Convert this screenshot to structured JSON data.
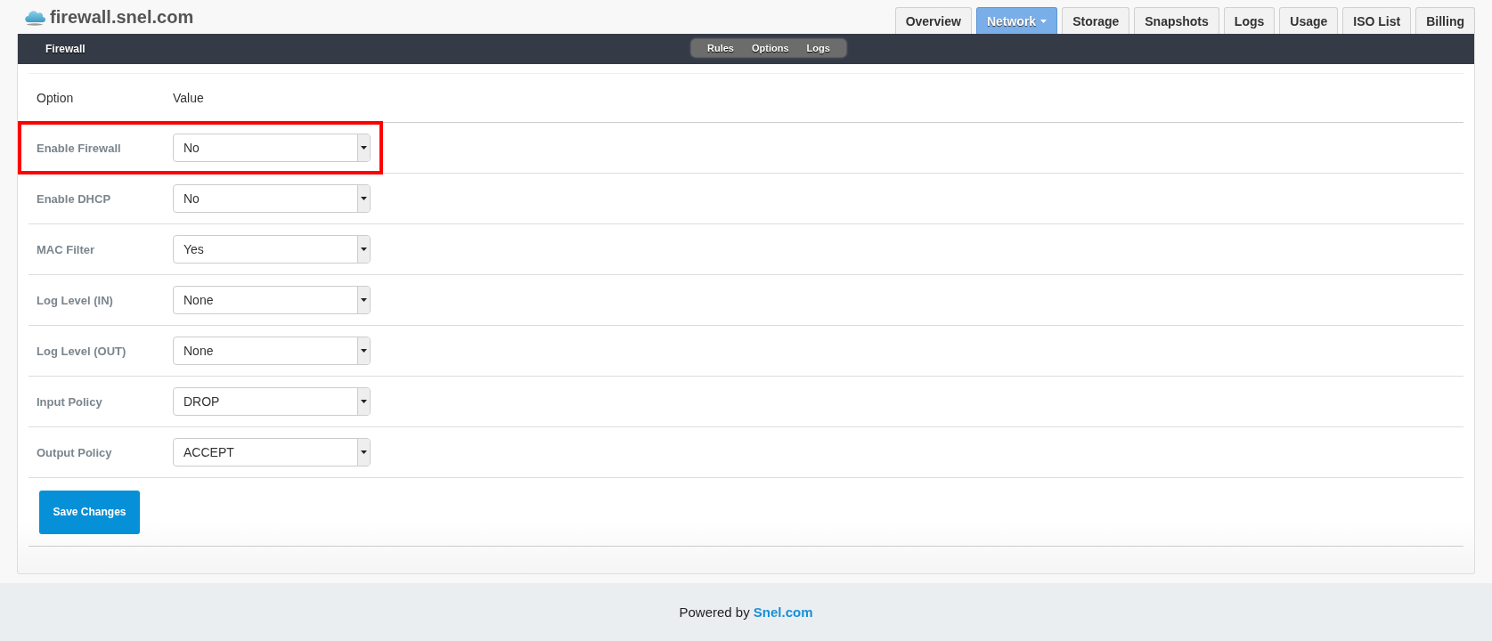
{
  "site": {
    "title": "firewall.snel.com"
  },
  "tabs": [
    {
      "label": "Overview",
      "selected": false,
      "dropdown": false
    },
    {
      "label": "Network",
      "selected": true,
      "dropdown": true
    },
    {
      "label": "Storage",
      "selected": false,
      "dropdown": false
    },
    {
      "label": "Snapshots",
      "selected": false,
      "dropdown": false
    },
    {
      "label": "Logs",
      "selected": false,
      "dropdown": false
    },
    {
      "label": "Usage",
      "selected": false,
      "dropdown": false
    },
    {
      "label": "ISO List",
      "selected": false,
      "dropdown": false
    },
    {
      "label": "Billing",
      "selected": false,
      "dropdown": false
    }
  ],
  "section": {
    "title": "Firewall",
    "subtabs": [
      {
        "label": "Rules"
      },
      {
        "label": "Options"
      },
      {
        "label": "Logs"
      }
    ]
  },
  "table": {
    "columns": [
      "Option",
      "Value"
    ],
    "rows": [
      {
        "option": "Enable Firewall",
        "value": "No",
        "highlighted": true
      },
      {
        "option": "Enable DHCP",
        "value": "No",
        "highlighted": false
      },
      {
        "option": "MAC Filter",
        "value": "Yes",
        "highlighted": false
      },
      {
        "option": "Log Level (IN)",
        "value": "None",
        "highlighted": false
      },
      {
        "option": "Log Level (OUT)",
        "value": "None",
        "highlighted": false
      },
      {
        "option": "Input Policy",
        "value": "DROP",
        "highlighted": false
      },
      {
        "option": "Output Policy",
        "value": "ACCEPT",
        "highlighted": false
      }
    ]
  },
  "save_button": "Save Changes",
  "footer": {
    "text": "Powered by",
    "link": "Snel.com"
  }
}
